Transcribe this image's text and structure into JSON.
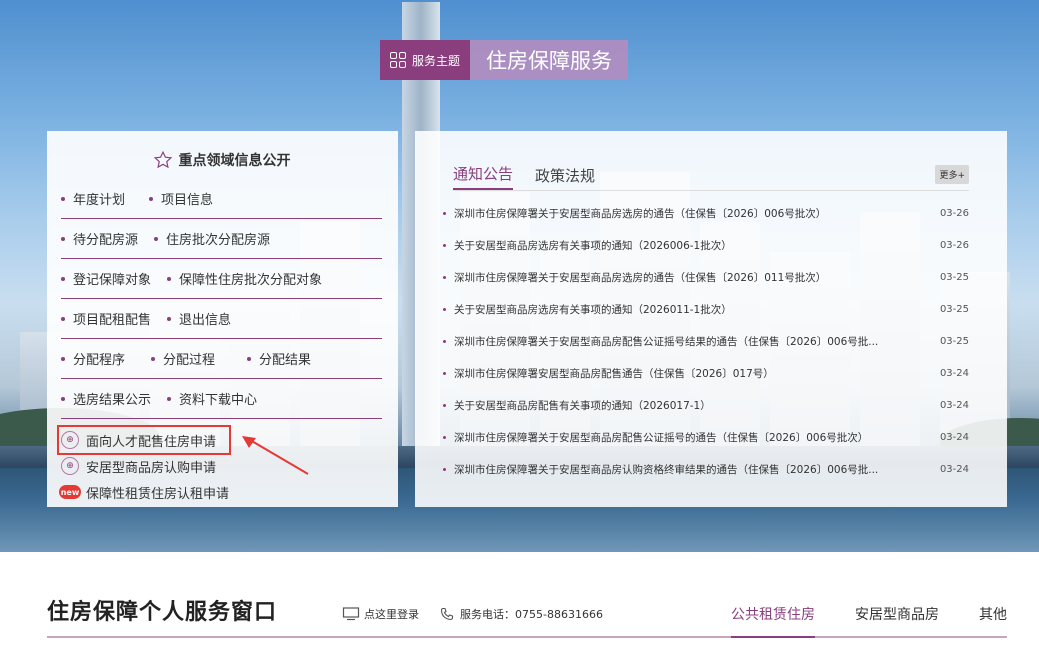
{
  "banner": {
    "tag": "服务主题",
    "title": "住房保障服务"
  },
  "left_panel": {
    "title": "重点领域信息公开",
    "rows": [
      [
        "年度计划",
        "项目信息"
      ],
      [
        "待分配房源",
        "住房批次分配房源"
      ],
      [
        "登记保障对象",
        "保障性住房批次分配对象"
      ],
      [
        "项目配租配售",
        "退出信息"
      ],
      [
        "分配程序",
        "分配过程",
        "分配结果"
      ],
      [
        "选房结果公示",
        "资料下载中心"
      ]
    ],
    "apps": [
      {
        "label": "面向人才配售住房申请",
        "icon": "application-icon"
      },
      {
        "label": "安居型商品房认购申请",
        "icon": "application-icon"
      },
      {
        "label": "保障性租赁住房认租申请",
        "icon": "new-badge-icon",
        "badge": "new"
      }
    ]
  },
  "right_panel": {
    "tabs": [
      "通知公告",
      "政策法规"
    ],
    "more": "更多+",
    "news": [
      {
        "title": "深圳市住房保障署关于安居型商品房选房的通告（住保售〔2026〕006号批次）",
        "date": "03-26"
      },
      {
        "title": "关于安居型商品房选房有关事项的通知（2026006-1批次）",
        "date": "03-26"
      },
      {
        "title": "深圳市住房保障署关于安居型商品房选房的通告（住保售〔2026〕011号批次）",
        "date": "03-25"
      },
      {
        "title": "关于安居型商品房选房有关事项的通知（2026011-1批次）",
        "date": "03-25"
      },
      {
        "title": "深圳市住房保障署关于安居型商品房配售公证摇号结果的通告（住保售〔2026〕006号批...",
        "date": "03-25"
      },
      {
        "title": "深圳市住房保障署安居型商品房配售通告（住保售〔2026〕017号）",
        "date": "03-24"
      },
      {
        "title": "关于安居型商品房配售有关事项的通知（2026017-1）",
        "date": "03-24"
      },
      {
        "title": "深圳市住房保障署关于安居型商品房配售公证摇号的通告（住保售〔2026〕006号批次）",
        "date": "03-24"
      },
      {
        "title": "深圳市住房保障署关于安居型商品房认购资格终审结果的通告（住保售〔2026〕006号批...",
        "date": "03-24"
      }
    ]
  },
  "bottom": {
    "title": "住房保障个人服务窗口",
    "login": "点这里登录",
    "phone": "服务电话：0755-88631666",
    "tabs": [
      "公共租赁住房",
      "安居型商品房",
      "其他"
    ]
  },
  "colors": {
    "accent": "#8a3e7e",
    "arrow": "#e53935"
  }
}
